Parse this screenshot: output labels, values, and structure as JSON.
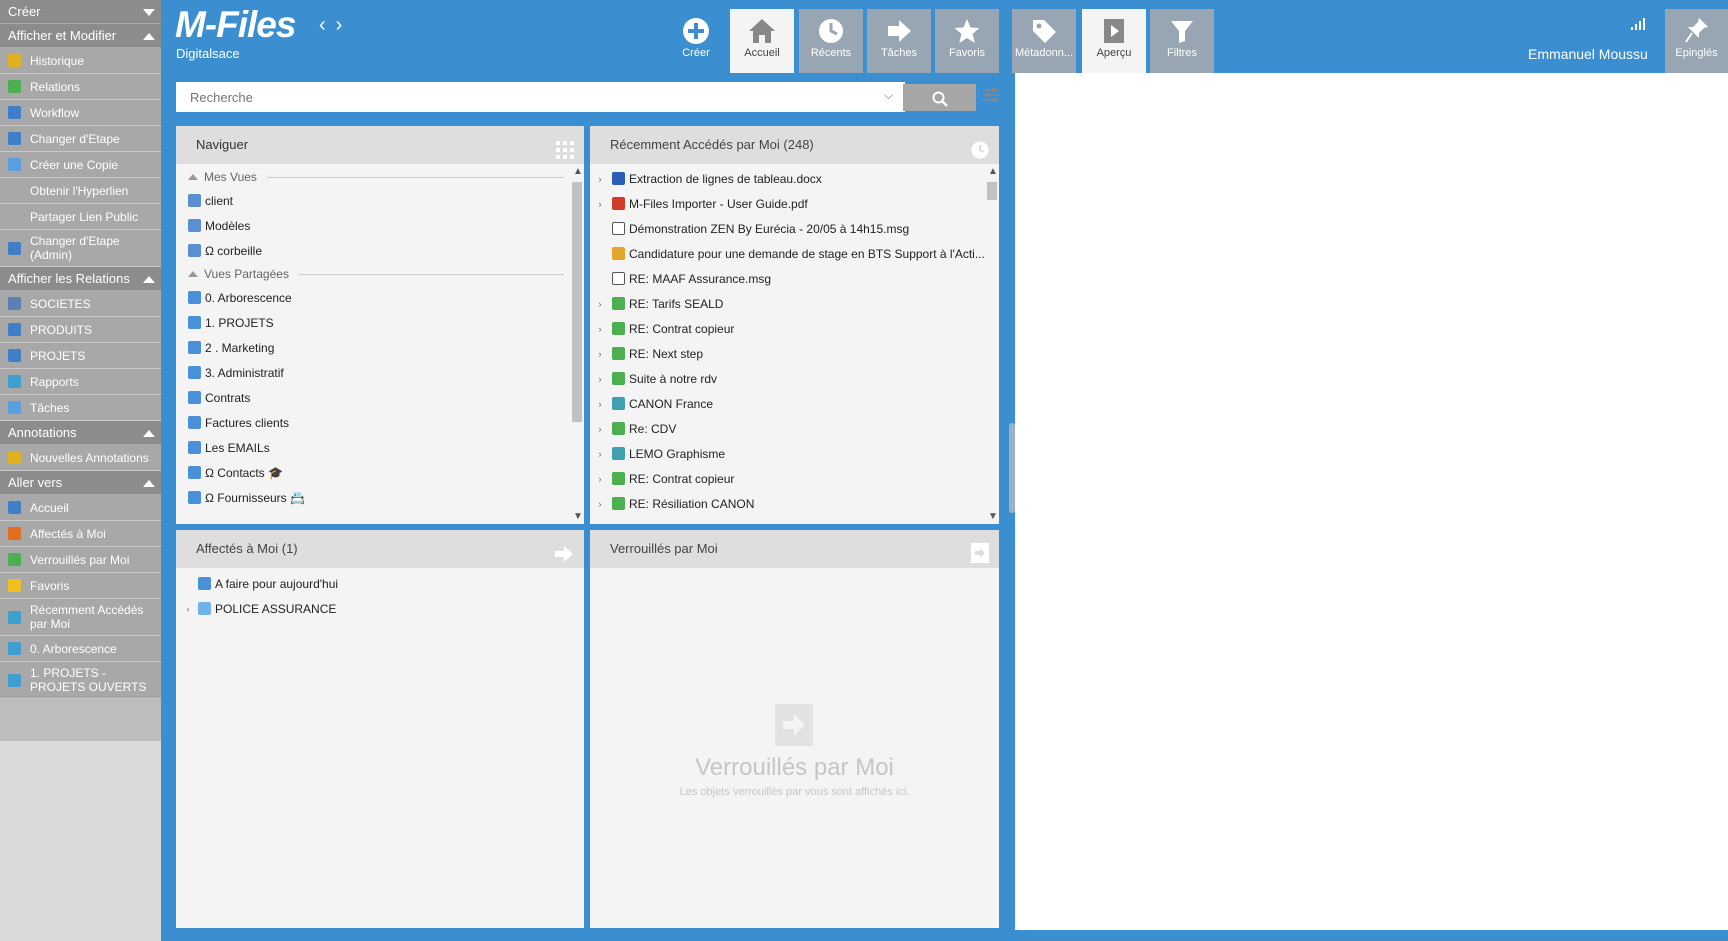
{
  "sidebar": {
    "create_label": "Créer",
    "sections": [
      {
        "label": "Afficher et Modifier",
        "items": [
          {
            "label": "Historique",
            "icon": "history-icon",
            "color": "#e0b020"
          },
          {
            "label": "Relations",
            "icon": "relations-icon",
            "color": "#4caf50"
          },
          {
            "label": "Workflow",
            "icon": "workflow-icon",
            "color": "#3f7fc7"
          },
          {
            "label": "Changer d'Etape",
            "icon": "change-state-icon",
            "color": "#3f7fc7"
          },
          {
            "label": "Créer une Copie",
            "icon": "copy-icon",
            "color": "#5aa0e0"
          },
          {
            "label": "Obtenir l'Hyperlien",
            "icon": "",
            "color": ""
          },
          {
            "label": "Partager Lien Public",
            "icon": "",
            "color": ""
          },
          {
            "label": "Changer d'Etape (Admin)",
            "icon": "change-state-admin-icon",
            "color": "#3f7fc7"
          }
        ]
      },
      {
        "label": "Afficher les Relations",
        "items": [
          {
            "label": "SOCIETES",
            "icon": "company-icon",
            "color": "#5a7fb0"
          },
          {
            "label": "PRODUITS",
            "icon": "product-icon",
            "color": "#3f7fc7"
          },
          {
            "label": "PROJETS",
            "icon": "project-icon",
            "color": "#3f7fc7"
          },
          {
            "label": "Rapports",
            "icon": "report-icon",
            "color": "#3f9fd0"
          },
          {
            "label": "Tâches",
            "icon": "task-icon",
            "color": "#5aa0e0"
          }
        ]
      },
      {
        "label": "Annotations",
        "items": [
          {
            "label": "Nouvelles Annotations",
            "icon": "annotation-icon",
            "color": "#e0b020"
          }
        ]
      },
      {
        "label": "Aller vers",
        "items": [
          {
            "label": "Accueil",
            "icon": "home-icon",
            "color": "#3f7fc7"
          },
          {
            "label": "Affectés à Moi",
            "icon": "assigned-icon",
            "color": "#e07020"
          },
          {
            "label": "Verrouillés par Moi",
            "icon": "checked-out-icon",
            "color": "#4caf50"
          },
          {
            "label": "Favoris",
            "icon": "star-icon",
            "color": "#f0c020"
          },
          {
            "label": "Récemment Accédés par Moi",
            "icon": "recent-icon",
            "color": "#3f9fd0"
          },
          {
            "label": "0.  Arborescence",
            "icon": "folder-icon",
            "color": "#3f9fd0"
          },
          {
            "label": "1. PROJETS - PROJETS OUVERTS",
            "icon": "folder-icon",
            "color": "#3f9fd0"
          }
        ]
      }
    ]
  },
  "header": {
    "logo": "M-Files",
    "vault": "Digitalsace",
    "back": "‹",
    "forward": "›",
    "create_label": "Créer",
    "tabs": [
      "Accueil",
      "Récents",
      "Tâches",
      "Favoris"
    ],
    "right_tabs": [
      "Métadonn...",
      "Aperçu",
      "Filtres"
    ],
    "user": "Emmanuel Moussu",
    "pinned": "Epinglés"
  },
  "search": {
    "placeholder": "Recherche"
  },
  "navigate": {
    "title": "Naviguer",
    "my_views_label": "Mes Vues",
    "my_views": [
      "client",
      "Modèles",
      "Ω corbeille"
    ],
    "shared_views_label": "Vues Partagées",
    "shared_views": [
      "0.  Arborescence",
      "1. PROJETS",
      "2 . Marketing",
      "3. Administratif",
      "Contrats",
      "Factures clients",
      "Les EMAILs",
      "Ω Contacts 🎓",
      "Ω Fournisseurs 📇"
    ]
  },
  "recent": {
    "title": "Récemment Accédés par Moi (248)",
    "items": [
      {
        "label": "Extraction de lignes de tableau.docx",
        "type": "word",
        "expand": true
      },
      {
        "label": "M-Files Importer - User Guide.pdf",
        "type": "pdf",
        "expand": true
      },
      {
        "label": "Démonstration ZEN By Eurécia - 20/05 à 14h15.msg",
        "type": "mail",
        "expand": false
      },
      {
        "label": "Candidature pour une demande de stage en BTS Support à l'Acti...",
        "type": "chrome",
        "expand": false
      },
      {
        "label": "RE: MAAF Assurance.msg",
        "type": "mail",
        "expand": false
      },
      {
        "label": "RE: Tarifs SEALD",
        "type": "doc",
        "expand": true
      },
      {
        "label": "RE: Contrat copieur",
        "type": "doc",
        "expand": true
      },
      {
        "label": "RE: Next step",
        "type": "doc",
        "expand": true
      },
      {
        "label": "Suite à notre rdv",
        "type": "doc",
        "expand": true
      },
      {
        "label": "CANON France",
        "type": "company",
        "expand": true
      },
      {
        "label": "Re: CDV",
        "type": "doc",
        "expand": true
      },
      {
        "label": "LEMO Graphisme",
        "type": "company",
        "expand": true
      },
      {
        "label": "RE: Contrat copieur",
        "type": "doc",
        "expand": true
      },
      {
        "label": "RE: Résiliation CANON",
        "type": "doc",
        "expand": true
      }
    ]
  },
  "assigned": {
    "title": "Affectés à Moi (1)",
    "items": [
      {
        "label": "A faire pour aujourd'hui",
        "expand": false
      },
      {
        "label": "POLICE ASSURANCE",
        "expand": true
      }
    ]
  },
  "checked_out": {
    "title": "Verrouillés par Moi",
    "empty_title": "Verrouillés par Moi",
    "empty_sub": "Les objets verrouillés par vous sont affichés ici."
  }
}
